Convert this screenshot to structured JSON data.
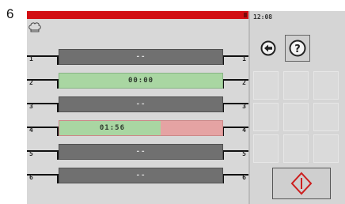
{
  "step_number": "6",
  "clock": "12:08",
  "header": {
    "chef_icon": "chef-hat-icon"
  },
  "rows": [
    {
      "index": "1",
      "state": "inactive",
      "value": "--"
    },
    {
      "index": "2",
      "state": "active",
      "value": "00:00"
    },
    {
      "index": "3",
      "state": "inactive",
      "value": "--"
    },
    {
      "index": "4",
      "state": "running",
      "value": "01:56",
      "progress": 0.62
    },
    {
      "index": "5",
      "state": "inactive",
      "value": "--"
    },
    {
      "index": "6",
      "state": "inactive",
      "value": "--"
    }
  ],
  "controls": {
    "back_icon": "arrow-left-circle-icon",
    "help_label": "?",
    "stop_icon": "stop-diamond-icon"
  },
  "colors": {
    "top_bar": "#d20f14",
    "active": "#a9d6a2",
    "alarm": "#e5a3a3",
    "inactive": "#707070"
  }
}
